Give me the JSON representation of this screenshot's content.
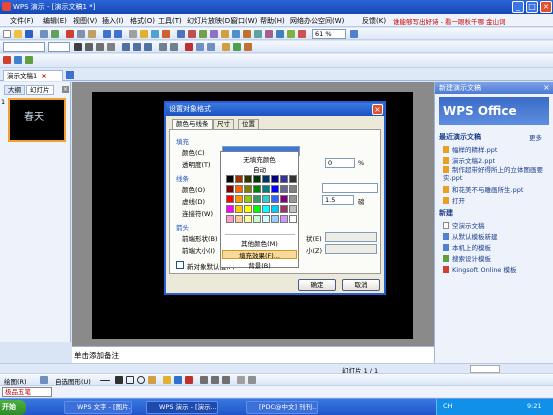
{
  "window": {
    "title": "WPS 演示 - [演示文稿1 *]"
  },
  "menu": {
    "items": [
      "文件(F)",
      "编辑(E)",
      "视图(V)",
      "插入(I)",
      "格式(O)",
      "工具(T)",
      "幻灯片放映(D)",
      "窗口(W)",
      "帮助(H)",
      "网络办公空间(W)",
      "反馈(K)"
    ],
    "promo": "谁能够写出好诗 - 看一眼秋千哪 金山词"
  },
  "toolbar": {
    "font_size": "61",
    "zoom": "61 %"
  },
  "tabs": {
    "doc": "演示文稿1"
  },
  "leftpanel": {
    "tab_outline": "大纲",
    "tab_slides": "幻灯片",
    "thumb_num": "1",
    "thumb_text": "春天"
  },
  "notes": {
    "placeholder": "单击添加备注"
  },
  "taskpane": {
    "header": "新建演示文稿",
    "logo": "WPS Office",
    "recent_title": "最近演示文稿",
    "more": "更多",
    "recent": [
      "幅样的精样.ppt",
      "演示文稿2.ppt",
      "制作超带好得所上的立体图画要实.ppt",
      "和花美不与雕画所生.ppt",
      "打开"
    ],
    "new_title": "新建",
    "new_items": [
      "空演示文稿",
      "从默认模板新建",
      "本机上的模板",
      "搜索设计模板",
      "Kingsoft Online 模板"
    ]
  },
  "dialog": {
    "title": "设置对象格式",
    "tabs": [
      "颜色与线条",
      "尺寸",
      "位置"
    ],
    "fill_group": "填充",
    "color_label": "颜色(C)",
    "transparency_label": "透明度(T)",
    "transparency_val": "0",
    "pct": "%",
    "line_group": "线条",
    "line_color": "颜色(O)",
    "line_style": "虚线(D)",
    "line_weight": "连接符(W)",
    "weight_val": "1.5",
    "weight_unit": "磅",
    "arrow_group": "箭头",
    "arrow_start": "前端形状(B)",
    "arrow_size": "前端大小(I)",
    "arrow_end_suffix": "状(E)",
    "arrow_end_size_suffix": "小(Z)",
    "default_checkbox": "新对象默认值(F)",
    "ok": "确定",
    "cancel": "取消"
  },
  "dropdown": {
    "no_fill": "无填充颜色",
    "auto": "自动",
    "more_colors": "其他颜色(M)",
    "fill_effects": "填充效果(F)...",
    "background": "背景(B)",
    "swatches": [
      "#000000",
      "#993300",
      "#333300",
      "#003300",
      "#003366",
      "#000080",
      "#333399",
      "#333333",
      "#800000",
      "#ff6600",
      "#808000",
      "#008000",
      "#008080",
      "#0000ff",
      "#666699",
      "#808080",
      "#ff0000",
      "#ff9900",
      "#99cc00",
      "#339966",
      "#33cccc",
      "#3366ff",
      "#800080",
      "#969696",
      "#ff00ff",
      "#ffcc00",
      "#ffff00",
      "#00ff00",
      "#00ffff",
      "#00ccff",
      "#993366",
      "#c0c0c0",
      "#ff99cc",
      "#ffcc99",
      "#ffff99",
      "#ccffcc",
      "#ccffff",
      "#99ccff",
      "#cc99ff",
      "#ffffff"
    ]
  },
  "status": {
    "slide": "幻灯片 1 / 1",
    "zoom_label": "自动",
    "draw_label": "绘图(R)",
    "autoshapes": "自选图形(U)",
    "word_tool": "极品五笔"
  },
  "taskbar": {
    "start": "开始",
    "tasks": [
      "WPS 文字 - [图片...",
      "WPS 演示 - [演示...",
      "[PDC@中文] 刊刊..."
    ],
    "tray_items": [
      "CH",
      "9:21"
    ]
  }
}
